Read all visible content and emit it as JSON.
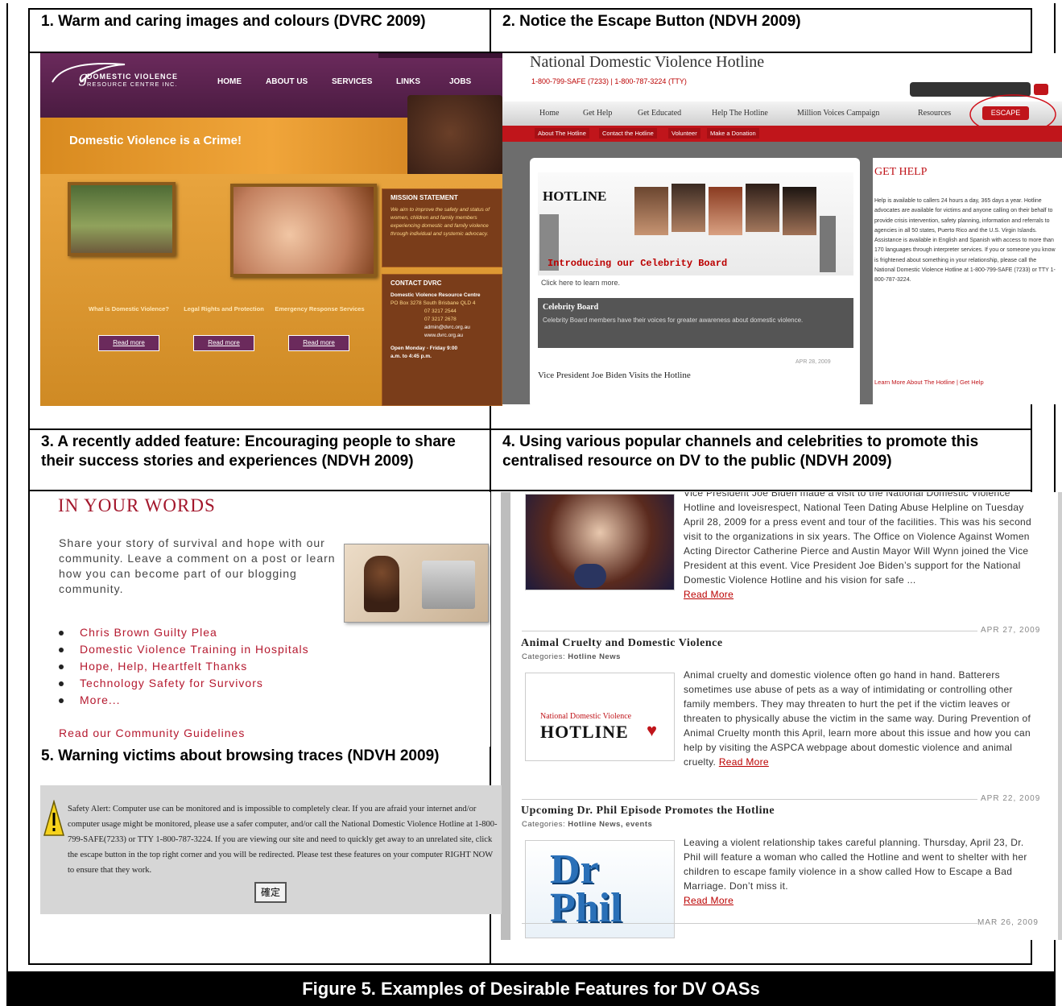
{
  "cells": {
    "c1_title": "1. Warm and caring images and colours (DVRC 2009)",
    "c2_title": "2. Notice the Escape Button (NDVH 2009)",
    "c3_title": "3. A recently added feature: Encouraging people to share their success stories and experiences (NDVH 2009)",
    "c4_title": "4. Using various popular channels and celebrities to promote this centralised resource on DV to the public (NDVH 2009)",
    "c5_title": "5. Warning victims about browsing traces (NDVH 2009)"
  },
  "dvrc": {
    "logo_line1": "DOMESTIC VIOLENCE",
    "logo_line2": "RESOURCE CENTRE INC.",
    "nav": [
      "HOME",
      "ABOUT US",
      "SERVICES",
      "LINKS",
      "JOBS"
    ],
    "headline": "Domestic Violence is a Crime!",
    "mission_title": "MISSION STATEMENT",
    "mission_text": "We aim to improve the safety and status of women, children and family members experiencing domestic and family violence through individual and systemic advocacy.",
    "contact_title": "CONTACT DVRC",
    "contact_org": "Domestic Violence Resource Centre",
    "contact_address": "PO Box 3278 South Brisbane QLD 4",
    "contact_phone": "07 3217 2544",
    "contact_fax": "07 3217 2678",
    "contact_email": "admin@dvrc.org.au",
    "contact_web": "www.dvrc.org.au",
    "hours": "Open Monday - Friday 9:00 a.m. to 4:45 p.m.",
    "links": [
      "What is Domestic Violence?",
      "Legal Rights and Protection",
      "Emergency Response Services"
    ],
    "read_more": "Read more"
  },
  "ndvh_home": {
    "title": "National Domestic Violence Hotline",
    "phone": "1-800-799-SAFE (7233) | 1-800-787-3224 (TTY)",
    "nav": [
      "Home",
      "Get Help",
      "Get Educated",
      "Help The Hotline",
      "Million Voices Campaign",
      "Resources"
    ],
    "escape": "ESCAPE",
    "subnav": [
      "About The Hotline",
      "Contact the Hotline",
      "Volunteer",
      "Make a Donation"
    ],
    "feature": "Introducing our Celebrity Board",
    "click_here": "Click here to learn more.",
    "board_title": "Celebrity Board",
    "board_text": "Celebrity Board members have their voices for greater awareness about domestic violence.",
    "date": "APR 28, 2009",
    "post_title": "Vice President Joe Biden Visits the Hotline",
    "get_help_title": "GET HELP",
    "get_help_text": "Help is available to callers 24 hours a day, 365 days a year. Hotline advocates are available for victims and anyone calling on their behalf to provide crisis intervention, safety planning, information and referrals to agencies in all 50 states, Puerto Rico and the U.S. Virgin Islands. Assistance is available in English and Spanish with access to more than 170 languages through interpreter services. If you or someone you know is frightened about something in your relationship, please call the National Domestic Violence Hotline at 1-800-799-SAFE (7233) or TTY 1-800-787-3224.",
    "learn_more": "Learn More About The Hotline | Get Help"
  },
  "your_words": {
    "heading": "IN YOUR WORDS",
    "intro": "Share your story of survival and hope with our community. Leave a comment on a post or learn how you can become part of our blogging community.",
    "items": [
      "Chris Brown Guilty Plea",
      "Domestic Violence Training in Hospitals",
      "Hope, Help, Heartfelt Thanks",
      "Technology Safety for Survivors",
      "More..."
    ],
    "guidelines": "Read our Community Guidelines"
  },
  "blog": {
    "post1_text": "Vice President Joe Biden made a visit to the National Domestic Violence Hotline and loveisrespect, National Teen Dating Abuse Helpline on Tuesday April 28, 2009 for a press event and tour of the facilities. This was his second visit to the organizations in six years. The Office on Violence Against Women Acting Director Catherine Pierce and Austin Mayor Will Wynn joined the Vice President at this event. Vice President Joe Biden’s support for the National Domestic Violence Hotline and his vision for safe ...",
    "read_more": "Read More",
    "date1": "APR 27, 2009",
    "post2_title": "Animal Cruelty and Domestic Violence",
    "categories_label": "Categories:",
    "post2_cats": "Hotline News",
    "post2_text": "Animal cruelty and domestic violence often go hand in hand. Batterers sometimes use abuse of pets as a way of intimidating or controlling other family members. They may threaten to hurt the pet if the victim leaves or threaten to physically abuse the victim in the same way. During Prevention of Animal Cruelty month this April, learn more about this issue and how you can help by visiting the ASPCA webpage about domestic violence and animal cruelty.",
    "date2": "APR 22, 2009",
    "post3_title": "Upcoming Dr. Phil Episode Promotes the Hotline",
    "post3_cats": "Hotline News, events",
    "post3_text": "Leaving a violent relationship takes careful planning. Thursday, April 23, Dr. Phil will feature a woman who called the Hotline and went to shelter with her children to escape family violence in a show called How to Escape a Bad Marriage. Don’t miss it.",
    "date3": "MAR 26, 2009",
    "logo_top": "National Domestic Violence",
    "logo_main": "HOTLINE",
    "drphil": "Dr Phil"
  },
  "alert": {
    "text": "Safety Alert: Computer use can be monitored and is impossible to completely clear. If you are afraid your internet and/or computer usage might be monitored, please use a safer computer, and/or call the National Domestic Violence Hotline at 1-800-799-SAFE(7233) or TTY 1-800-787-3224. If you are viewing our site and need to quickly get away to an unrelated site, click the escape button in the top right corner and you will be redirected. Please test these features on your computer RIGHT NOW to ensure that they work.",
    "ok": "確定"
  },
  "caption": "Figure 5. Examples of Desirable Features for DV OASs"
}
